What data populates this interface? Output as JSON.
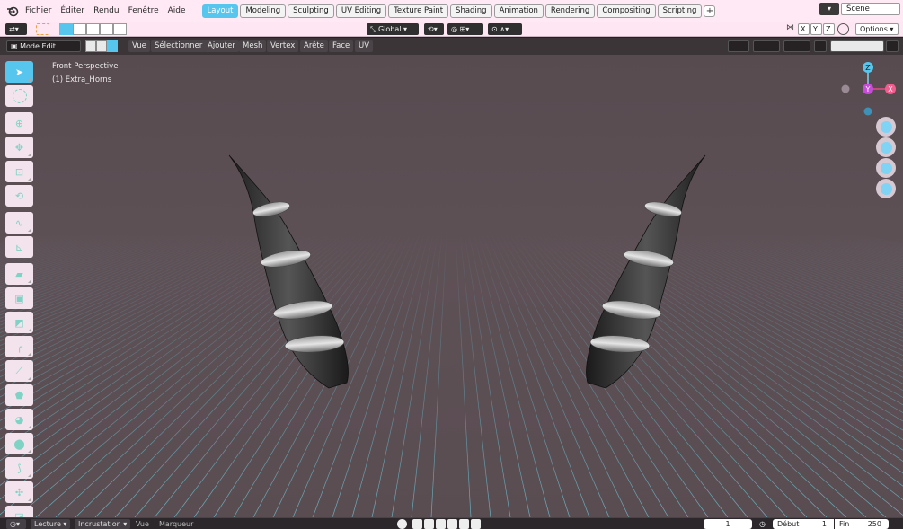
{
  "menu": {
    "items": [
      "Fichier",
      "Éditer",
      "Rendu",
      "Fenêtre",
      "Aide"
    ]
  },
  "workspaces": [
    {
      "label": "Layout",
      "active": true
    },
    {
      "label": "Modeling",
      "active": false
    },
    {
      "label": "Sculpting",
      "active": false
    },
    {
      "label": "UV Editing",
      "active": false
    },
    {
      "label": "Texture Paint",
      "active": false
    },
    {
      "label": "Shading",
      "active": false
    },
    {
      "label": "Animation",
      "active": false
    },
    {
      "label": "Rendering",
      "active": false
    },
    {
      "label": "Compositing",
      "active": false
    },
    {
      "label": "Scripting",
      "active": false
    }
  ],
  "scene": {
    "label": "Scene"
  },
  "toolheader": {
    "orientation": "Global",
    "options": "Options",
    "axes": [
      "X",
      "Y",
      "Z"
    ]
  },
  "viewport_header": {
    "mode": "Mode Edit",
    "menus": [
      "Vue",
      "Sélectionner",
      "Ajouter",
      "Mesh",
      "Vertex",
      "Arête",
      "Face",
      "UV"
    ]
  },
  "viewport": {
    "view_name": "Front Perspective",
    "object_name": "(1) Extra_Horns",
    "gizmo_axes": {
      "z": "Z",
      "y": "Y",
      "x": "X"
    }
  },
  "timeline": {
    "playback": "Lecture",
    "keying": "Incrustation",
    "view": "Vue",
    "marker": "Marqueur",
    "current_frame": "1",
    "start_label": "Début",
    "start": "1",
    "end_label": "Fin",
    "end": "250"
  },
  "colors": {
    "accent": "#57c6ee",
    "topbar_bg": "#ffe9f5",
    "grid_line": "#5fa7b8"
  }
}
